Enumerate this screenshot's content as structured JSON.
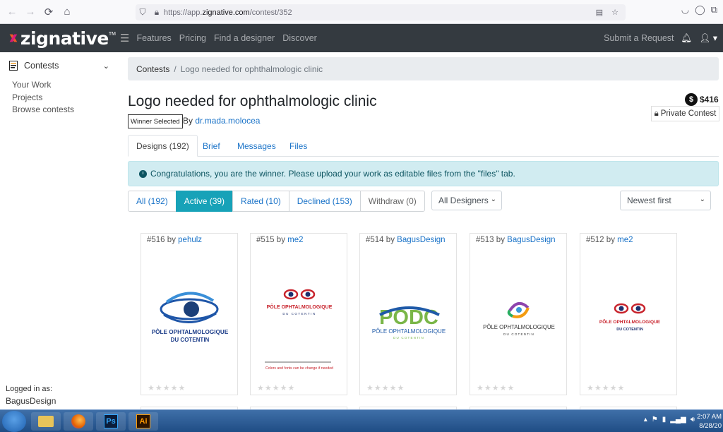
{
  "browser": {
    "url_prefix": "https://app.",
    "url_domain": "zignative.com",
    "url_path": "/contest/352"
  },
  "nav": {
    "brand": "zignative",
    "brand_tm": "TM",
    "links": [
      "Features",
      "Pricing",
      "Find a designer",
      "Discover"
    ],
    "submit_request": "Submit a Request"
  },
  "sidebar": {
    "section": "Contests",
    "items": [
      "Your Work",
      "Projects",
      "Browse contests"
    ],
    "logged_in_label": "Logged in as:",
    "logged_in_user": "BagusDesign"
  },
  "breadcrumb": {
    "root": "Contests",
    "separator": "/",
    "current": "Logo needed for ophthalmologic clinic"
  },
  "contest": {
    "title": "Logo needed for ophthalmologic clinic",
    "badge": "Winner Selected",
    "by_prefix": "By",
    "owner": "dr.mada.molocea",
    "price": "$416",
    "private_label": "Private Contest"
  },
  "tabs": [
    "Designs (192)",
    "Brief",
    "Messages",
    "Files"
  ],
  "alert": "Congratulations, you are the winner. Please upload your work as editable files from the \"files\" tab.",
  "filters": [
    "All (192)",
    "Active (39)",
    "Rated (10)",
    "Declined (153)",
    "Withdraw (0)"
  ],
  "designer_select": "All Designers",
  "sort_select": "Newest first",
  "cards": [
    {
      "number": "#516",
      "by": "by",
      "designer": "pehulz",
      "logo_line1": "PÔLE OPHTALMOLOGIQUE",
      "logo_line2": "DU COTENTIN"
    },
    {
      "number": "#515",
      "by": "by",
      "designer": "me2",
      "logo_line1": "PÔLE OPHTALMOLOGIQUE",
      "logo_line2": "DU COTENTIN",
      "note": "Colors and fonts can be change if needed"
    },
    {
      "number": "#514",
      "by": "by",
      "designer": "BagusDesign",
      "logo_mark": "PODC",
      "logo_line1": "PÔLE OPHTALMOLOGIQUE",
      "logo_line2": "DU COTENTIN"
    },
    {
      "number": "#513",
      "by": "by",
      "designer": "BagusDesign",
      "logo_line1": "PÔLE OPHTALMOLOGIQUE",
      "logo_line2": "DU COTENTIN"
    },
    {
      "number": "#512",
      "by": "by",
      "designer": "me2",
      "logo_line1": "PÔLE OPHTALMOLOGIQUE",
      "logo_line2": "DU COTENTIN"
    }
  ],
  "taskbar": {
    "apps": [
      "Ps",
      "Ai"
    ],
    "time": "2:07 AM",
    "date": "8/28/20"
  },
  "colors": {
    "navbar": "#343a40",
    "link": "#1a73c8",
    "active_filter": "#17a2b8",
    "alert_bg": "#d1ecf1",
    "logo_orange": "#f15a24",
    "logo_pink": "#e0197d"
  }
}
